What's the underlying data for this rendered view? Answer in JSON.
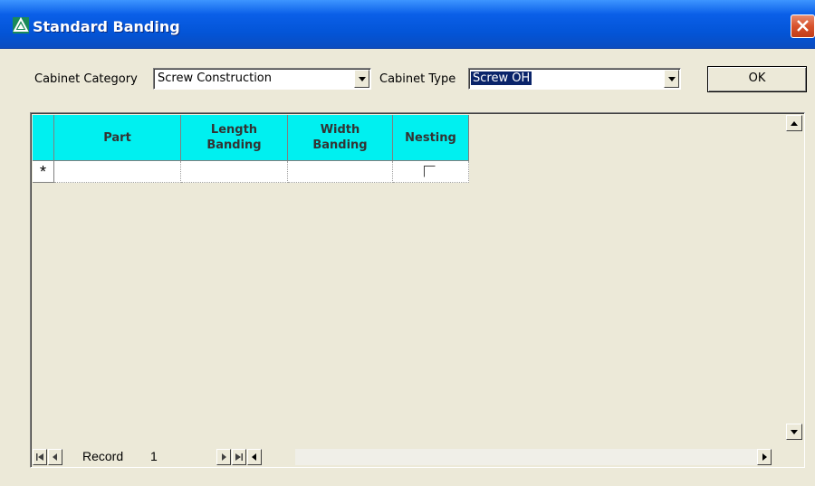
{
  "window": {
    "title": "Standard Banding"
  },
  "toolbar": {
    "cabinet_category_label": "Cabinet Category",
    "cabinet_category_value": "Screw Construction",
    "cabinet_type_label": "Cabinet Type",
    "cabinet_type_value": "Screw OH",
    "ok_label": "OK"
  },
  "grid": {
    "columns": [
      "Part",
      "Length Banding",
      "Width Banding",
      "Nesting"
    ],
    "new_row_marker": "*",
    "rows": []
  },
  "navigator": {
    "record_label": "Record",
    "record_number": "1"
  },
  "colors": {
    "title_bar": "#0354d6",
    "header_bg": "#00f0f0",
    "dialog_bg": "#ece9d8",
    "selection": "#0a246a",
    "close_button": "#d8522c"
  }
}
